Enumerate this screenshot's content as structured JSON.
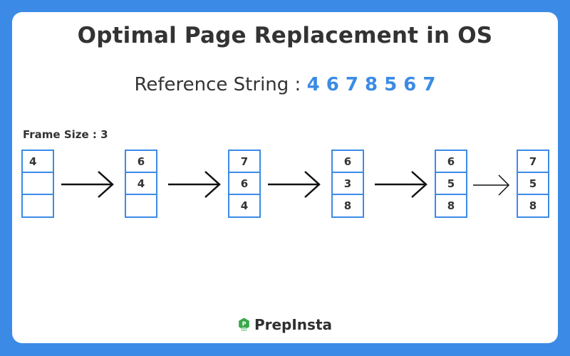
{
  "title": "Optimal Page Replacement in OS",
  "reference": {
    "label": "Reference String :",
    "sequence": "4 6 7 8 5 6 7"
  },
  "frame_size_label": "Frame Size : 3",
  "frames": [
    [
      "4",
      "",
      ""
    ],
    [
      "6",
      "4",
      ""
    ],
    [
      "7",
      "6",
      "4"
    ],
    [
      "6",
      "3",
      "8"
    ],
    [
      "6",
      "5",
      "8"
    ],
    [
      "7",
      "5",
      "8"
    ]
  ],
  "logo": {
    "text": "PrepInsta"
  },
  "colors": {
    "accent": "#3b8be6",
    "text": "#333333",
    "logo_green": "#3aa84a"
  }
}
